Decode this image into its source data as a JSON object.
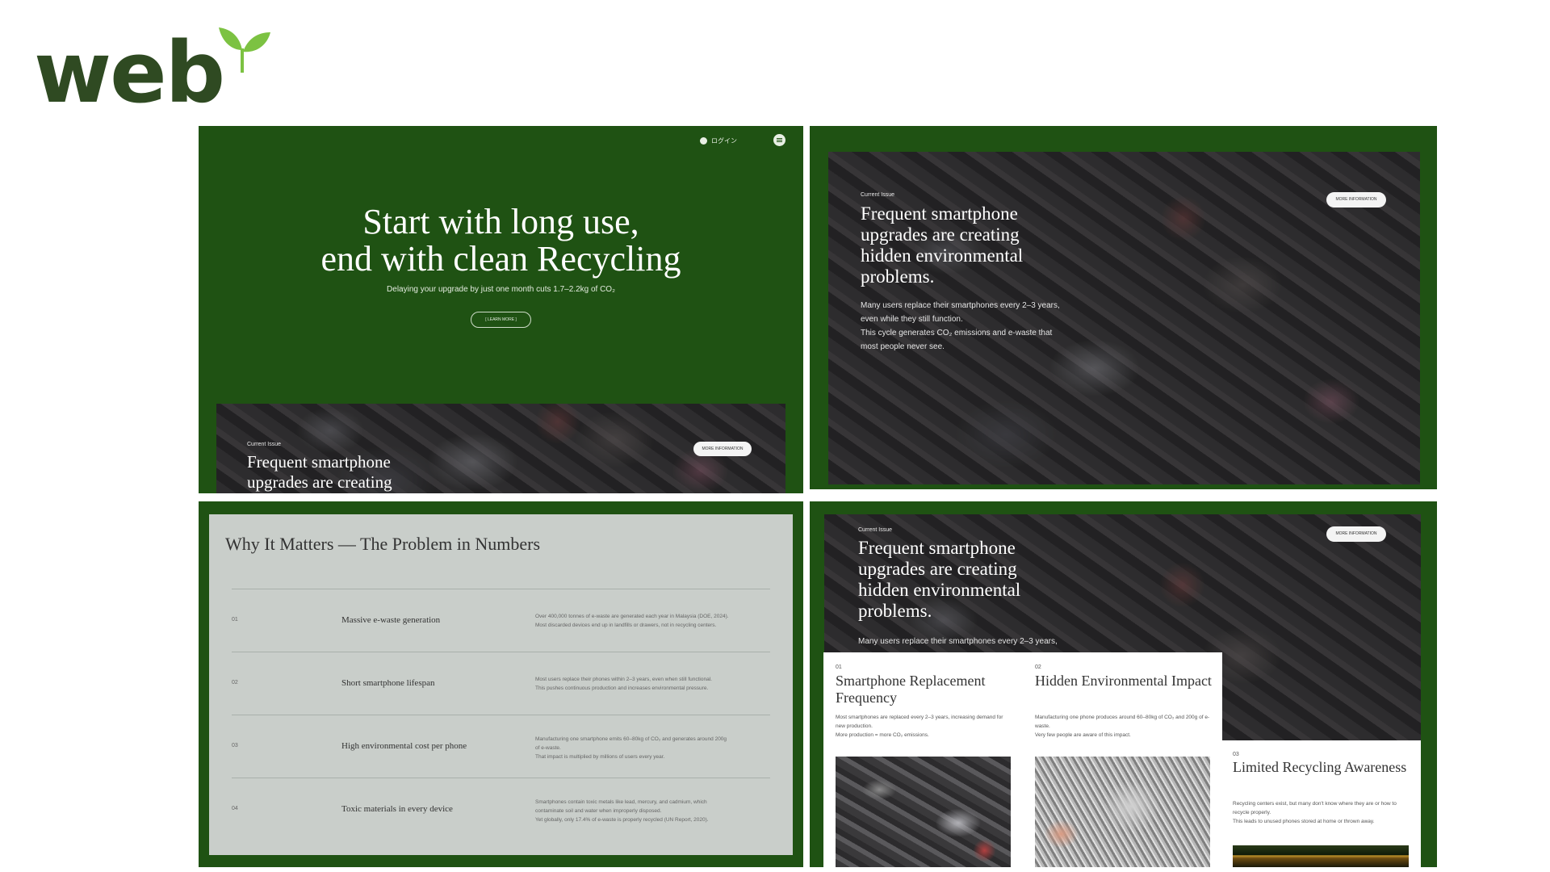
{
  "logo": {
    "text": "web",
    "icon": "sprout-leaf-icon",
    "color": "#2f4a22",
    "leaf_color": "#7cc242"
  },
  "theme": {
    "panel_green": "#1f5213",
    "card_gray": "#c9ceca"
  },
  "hero": {
    "login_label": "ログイン",
    "title_line1": "Start with long use,",
    "title_line2": "end with clean Recycling",
    "subtitle": "Delaying your upgrade by just one month cuts 1.7–2.2kg of CO₂",
    "button_label": "[ LEARN MORE ]"
  },
  "issue": {
    "label": "Current Issue",
    "title_full": "Frequent smartphone upgrades are creating hidden environmental problems.",
    "title_lines": [
      "Frequent smartphone",
      "upgrades are creating",
      "hidden environmental",
      "problems."
    ],
    "body_lines": [
      "Many users replace their smartphones every 2–3 years,",
      "even while they still function.",
      "This cycle generates CO₂ emissions and e-waste that",
      "most people never see."
    ],
    "more_button": "MORE INFORMATION"
  },
  "numbers": {
    "title": "Why It Matters — The Problem in Numbers",
    "rows": [
      {
        "num": "01",
        "name": "Massive e-waste generation",
        "desc": "Over 400,000 tonnes of e-waste are generated each year in Malaysia (DOE, 2024).\nMost discarded devices end up in landfills or drawers, not in recycling centers."
      },
      {
        "num": "02",
        "name": "Short smartphone lifespan",
        "desc": "Most users replace their phones within 2–3 years, even when still functional.\nThis pushes continuous production and increases environmental pressure."
      },
      {
        "num": "03",
        "name": "High environmental cost per phone",
        "desc": "Manufacturing one smartphone emits 60–80kg of CO₂ and generates around 200g\nof e-waste.\nThat impact is multiplied by millions of users every year."
      },
      {
        "num": "04",
        "name": "Toxic materials in every device",
        "desc": "Smartphones contain toxic metals like lead, mercury, and cadmium, which\ncontaminate soil and water when improperly disposed.\nYet globally, only 17.4% of e-waste is properly recycled (UN Report, 2020)."
      }
    ]
  },
  "features": [
    {
      "num": "01",
      "title": "Smartphone Replacement Frequency",
      "desc": "Most smartphones are replaced every 2–3 years, increasing demand for new production.\nMore production = more CO₂ emissions."
    },
    {
      "num": "02",
      "title": "Hidden Environmental Impact",
      "desc": "Manufacturing one phone produces around 60–80kg of CO₂ and 200g of e-waste.\nVery few people are aware of this impact."
    },
    {
      "num": "03",
      "title": "Limited Recycling Awareness",
      "desc": "Recycling centers exist, but many don't know where they are or how to recycle properly.\nThis leads to unused phones stored at home or thrown away."
    }
  ]
}
